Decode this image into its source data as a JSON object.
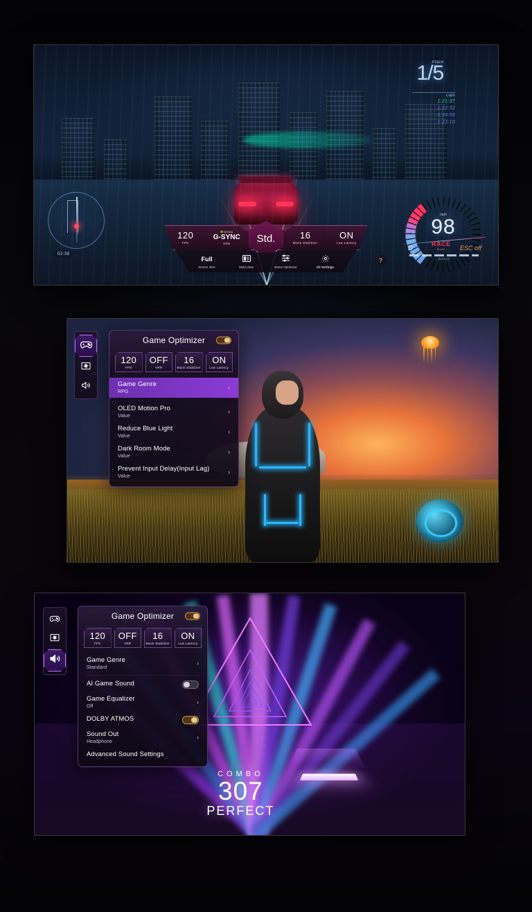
{
  "panel_racing": {
    "name": "Racing game with Game Dashboard overlay",
    "hud": {
      "place_label": "Place",
      "place_current": "1",
      "place_total": "5",
      "laps_label": "Laps",
      "lap_times": [
        "1:21:37",
        "1:22:32",
        "1:24:59",
        "1:23:10"
      ],
      "minimap_time": "02:39"
    },
    "speedometer": {
      "unit": "mph",
      "speed": "98",
      "gear": "D",
      "mode_value": "RACE",
      "mode_label": "Mode",
      "esc": "ESC off",
      "boost_label": "BOOST"
    },
    "dashboard": {
      "center_mode": "Std.",
      "stats": [
        {
          "value": "120",
          "label": "FPS"
        },
        {
          "value": "G-SYNC",
          "brand": "NVIDIA",
          "label": "VRR"
        },
        {
          "value": "16",
          "label": "Black Stabilizer"
        },
        {
          "value": "ON",
          "label": "Low Latency"
        }
      ],
      "tools": [
        {
          "value": "Full",
          "label": "Screen Size",
          "icon": "screen-size-icon"
        },
        {
          "value": "",
          "label": "Multi-view",
          "icon": "multi-view-icon"
        },
        {
          "value": "",
          "label": "Game Optimizer",
          "icon": "sliders-icon"
        },
        {
          "value": "",
          "label": "All Settings",
          "icon": "gear-icon"
        }
      ],
      "help_label": "?"
    }
  },
  "panel_game": {
    "name": "Sci-fi game with Game Optimizer picture menu",
    "rail": [
      {
        "icon": "gamepad-icon",
        "name": "game-mode-tab",
        "active": true
      },
      {
        "icon": "picture-icon",
        "name": "picture-tab",
        "active": false
      },
      {
        "icon": "speaker-icon",
        "name": "sound-tab",
        "active": false
      }
    ],
    "title": "Game Optimizer",
    "stats": [
      {
        "value": "120",
        "label": "FPS"
      },
      {
        "value": "OFF",
        "label": "VRR"
      },
      {
        "value": "16",
        "label": "Black Stabilizer"
      },
      {
        "value": "ON",
        "label": "Low Latency"
      }
    ],
    "rows": [
      {
        "label": "Game Genre",
        "sub": "RPG",
        "control": "chevron",
        "selected": true
      },
      {
        "label": "OLED Motion Pro",
        "sub": "Value",
        "control": "chevron",
        "selected": false
      },
      {
        "label": "Reduce Blue Light",
        "sub": "Value",
        "control": "chevron",
        "selected": false
      },
      {
        "label": "Dark Room Mode",
        "sub": "Value",
        "control": "chevron",
        "selected": false
      },
      {
        "label": "Prevent Input Delay(Input Lag)",
        "sub": "Value",
        "control": "chevron",
        "selected": false
      }
    ]
  },
  "panel_rhythm": {
    "name": "Rhythm game with Game Optimizer sound menu",
    "rail": [
      {
        "icon": "gamepad-icon",
        "name": "game-mode-tab",
        "active": false
      },
      {
        "icon": "picture-icon",
        "name": "picture-tab",
        "active": false
      },
      {
        "icon": "speaker-icon",
        "name": "sound-tab",
        "active": true
      }
    ],
    "title": "Game Optimizer",
    "stats": [
      {
        "value": "120",
        "label": "FPS"
      },
      {
        "value": "OFF",
        "label": "VRR"
      },
      {
        "value": "16",
        "label": "Black Stabilizer"
      },
      {
        "value": "ON",
        "label": "Low Latency"
      }
    ],
    "rows": [
      {
        "label": "Game Genre",
        "sub": "Standard",
        "control": "chevron",
        "selected": false
      },
      {
        "label": "AI Game Sound",
        "sub": "",
        "control": "toggle-off",
        "selected": false
      },
      {
        "label": "Game Equalizer",
        "sub": "Off",
        "control": "chevron",
        "selected": false
      },
      {
        "label": "DOLBY ATMOS",
        "sub": "",
        "control": "toggle-on",
        "selected": false
      },
      {
        "label": "Sound Out",
        "sub": "Headphone",
        "control": "chevron",
        "selected": false
      },
      {
        "label": "Advanced Sound Settings",
        "sub": "",
        "control": "none",
        "selected": false
      }
    ],
    "overlay": {
      "combo_label": "COMBO",
      "combo_value": "307",
      "judgement": "PERFECT"
    }
  },
  "colors": {
    "accent_purple": "#8b3bd4",
    "accent_magenta": "#ec5ac0",
    "gold": "#e7c98a",
    "neon_blue": "#2bb8ff",
    "race_red": "#ff2f4d"
  }
}
